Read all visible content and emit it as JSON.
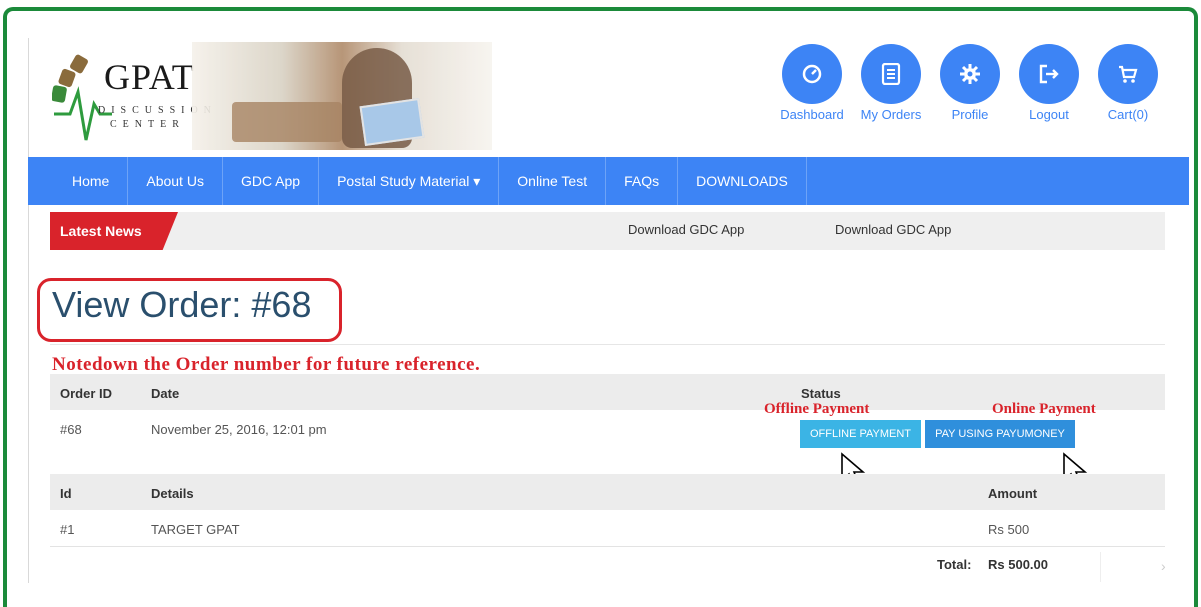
{
  "brand": {
    "title": "GPAT",
    "subtitle_line1": "DISCUSSION",
    "subtitle_line2": "CENTER"
  },
  "top_nav": [
    {
      "label": "Dashboard",
      "icon": "dashboard-icon"
    },
    {
      "label": "My Orders",
      "icon": "orders-icon"
    },
    {
      "label": "Profile",
      "icon": "gear-icon"
    },
    {
      "label": "Logout",
      "icon": "logout-icon"
    },
    {
      "label": "Cart(0)",
      "icon": "cart-icon"
    }
  ],
  "menu": [
    "Home",
    "About Us",
    "GDC App",
    "Postal Study Material ▾",
    "Online Test",
    "FAQs",
    "DOWNLOADS"
  ],
  "news": {
    "tag": "Latest News",
    "items": [
      "Download GDC App",
      "Download GDC App"
    ]
  },
  "page": {
    "title": "View Order: #68",
    "note": "Notedown the Order number for future reference."
  },
  "order_table": {
    "headers": {
      "order_id": "Order ID",
      "date": "Date",
      "status": "Status"
    },
    "row": {
      "order_id": "#68",
      "date": "November 25, 2016, 12:01 pm"
    },
    "offline_label": "Offline Payment",
    "online_label": "Online Payment",
    "offline_button": "OFFLINE PAYMENT",
    "payu_button": "PAY USING PAYUMONEY"
  },
  "items_table": {
    "headers": {
      "id": "Id",
      "details": "Details",
      "amount": "Amount"
    },
    "rows": [
      {
        "id": "#1",
        "details": "TARGET GPAT",
        "amount": "Rs 500"
      }
    ],
    "total_label": "Total:",
    "total_value": "Rs 500.00"
  },
  "colors": {
    "accent": "#3d84f5",
    "frame": "#1b8a3a",
    "alert": "#d9232b"
  }
}
